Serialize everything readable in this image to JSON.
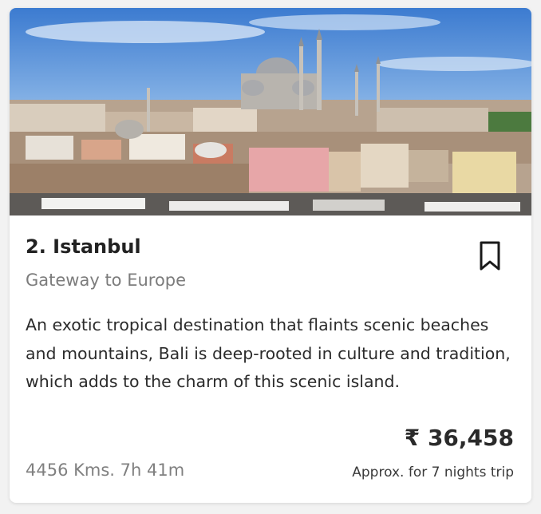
{
  "card": {
    "image_alt": "Istanbul skyline with mosque",
    "title": "2. Istanbul",
    "subtitle": "Gateway to Europe",
    "description": "An exotic tropical destination that flaints scenic beaches and mountains, Bali is deep-rooted in culture and tradition, which adds to the charm of this scenic island.",
    "price": "₹ 36,458",
    "price_note": "Approx. for 7 nights trip",
    "distance": "4456 Kms. 7h 41m",
    "bookmark_icon": "bookmark-icon"
  },
  "colors": {
    "title": "#222222",
    "subtitle": "#7c7c7c",
    "text": "#2b2b2b",
    "sky_top": "#3f7fd1",
    "sky_bottom": "#cfe3f6"
  }
}
